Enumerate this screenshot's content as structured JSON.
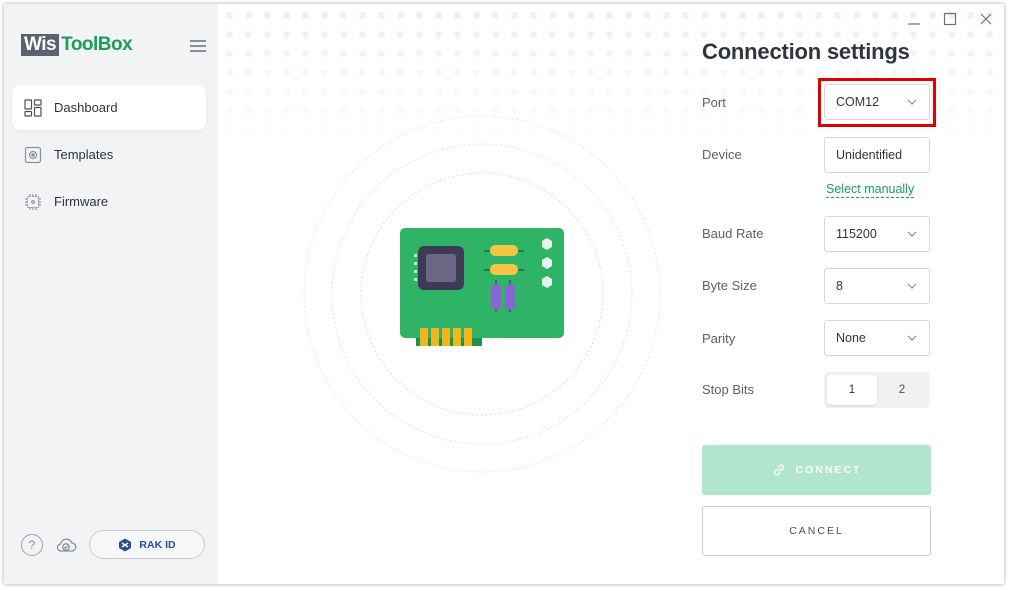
{
  "app": {
    "logo_left": "Wis",
    "logo_right": "ToolBox"
  },
  "sidebar": {
    "items": [
      {
        "label": "Dashboard",
        "icon": "dashboard-icon",
        "active": true
      },
      {
        "label": "Templates",
        "icon": "templates-icon",
        "active": false
      },
      {
        "label": "Firmware",
        "icon": "chip-icon",
        "active": false
      }
    ],
    "help_symbol": "?",
    "rak_id_label": "RAK ID"
  },
  "panel": {
    "title": "Connection settings",
    "port": {
      "label": "Port",
      "value": "COM12"
    },
    "device": {
      "label": "Device",
      "value": "Unidentified",
      "select_manually": "Select manually"
    },
    "baud_rate": {
      "label": "Baud Rate",
      "value": "115200"
    },
    "byte_size": {
      "label": "Byte Size",
      "value": "8"
    },
    "parity": {
      "label": "Parity",
      "value": "None"
    },
    "stop_bits": {
      "label": "Stop Bits",
      "options": [
        "1",
        "2"
      ],
      "selected": "1"
    },
    "connect_label": "CONNECT",
    "cancel_label": "CANCEL"
  },
  "colors": {
    "accent_green": "#1c9d5a",
    "connect_disabled": "#b2e5cd",
    "highlight_red": "#e00000",
    "sidebar_bg": "#f2f3f5"
  }
}
